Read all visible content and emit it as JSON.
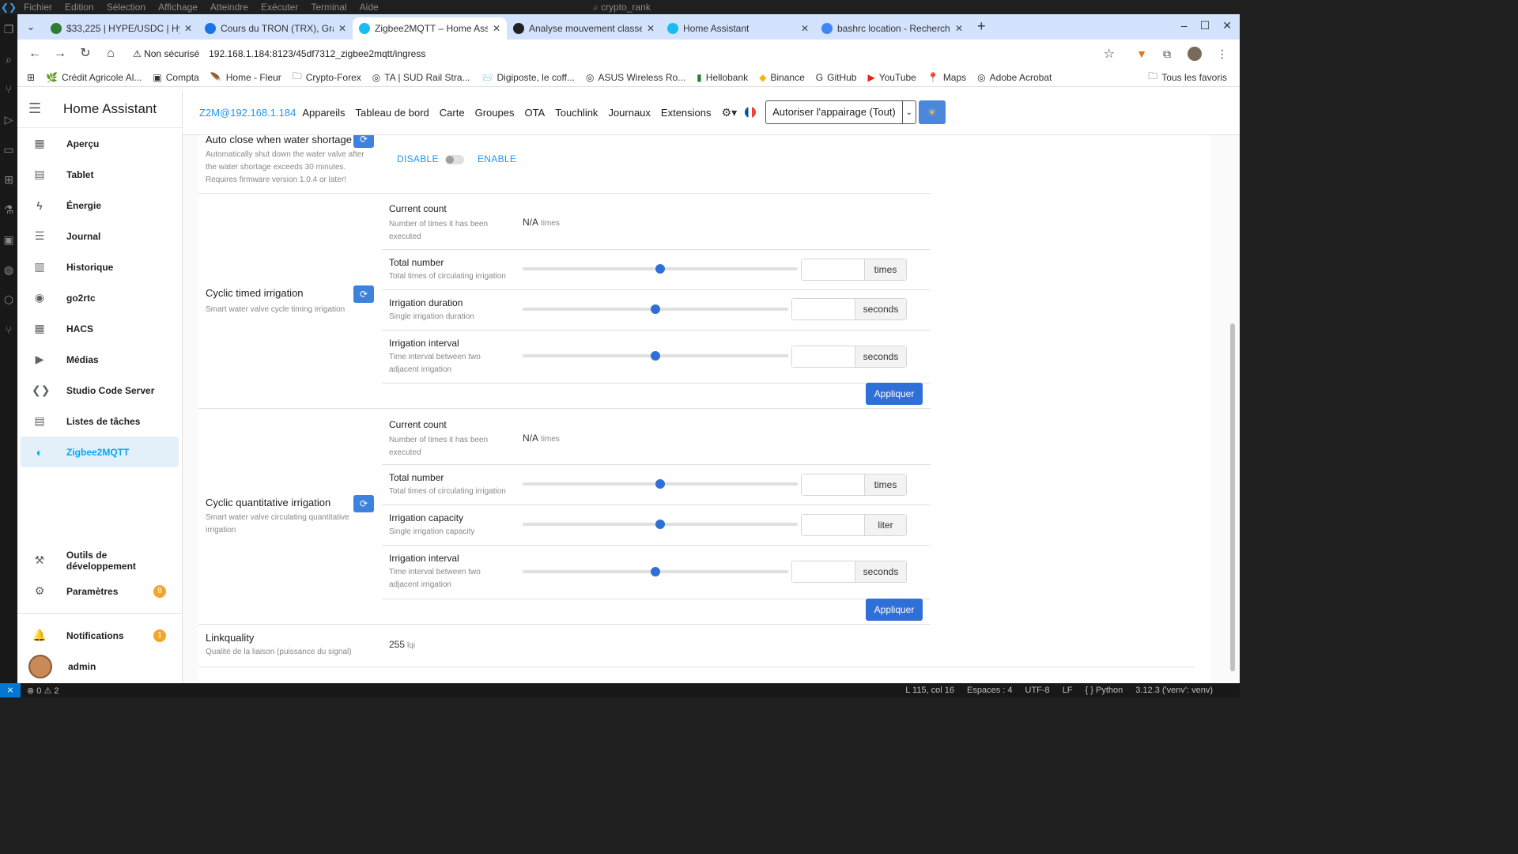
{
  "vscode": {
    "menu": [
      "Fichier",
      "Edition",
      "Sélection",
      "Affichage",
      "Atteindre",
      "Exécuter",
      "Terminal",
      "Aide"
    ],
    "command_center": "crypto_rank",
    "status": {
      "problems": "⊗ 0 ⚠ 2",
      "position": "L 115, col 16",
      "spaces": "Espaces : 4",
      "encoding": "UTF-8",
      "eol": "LF",
      "language": "{ } Python",
      "interpreter": "3.12.3 ('venv': venv)"
    }
  },
  "browser": {
    "tabs": [
      {
        "title": "$33,225 | HYPE/USDC | Hype",
        "color": "#2e7d32"
      },
      {
        "title": "Cours du TRON (TRX), Graph",
        "color": "#1a73e8"
      },
      {
        "title": "Zigbee2MQTT – Home Assist",
        "color": "#18bcf2"
      },
      {
        "title": "Analyse mouvement classem",
        "color": "#222222"
      },
      {
        "title": "Home Assistant",
        "color": "#18bcf2"
      },
      {
        "title": "bashrc location - Recherche",
        "color": "#4285f4"
      }
    ],
    "security_label": "Non sécurisé",
    "url": "192.168.1.184:8123/45df7312_zigbee2mqtt/ingress",
    "bookmarks": [
      {
        "label": "Crédit Agricole Al...",
        "icon": "🌿"
      },
      {
        "label": "Compta",
        "icon": "▣"
      },
      {
        "label": "Home - Fleur",
        "icon": "🪶"
      },
      {
        "label": "Crypto-Forex",
        "icon": "🗀"
      },
      {
        "label": "TA | SUD Rail Stra...",
        "icon": "◎"
      },
      {
        "label": "Digiposte, le coff...",
        "icon": "📨"
      },
      {
        "label": "ASUS Wireless Ro...",
        "icon": "◎"
      },
      {
        "label": "Hellobank",
        "icon": "▮"
      },
      {
        "label": "Binance",
        "icon": "◆"
      },
      {
        "label": "GitHub",
        "icon": "G"
      },
      {
        "label": "YouTube",
        "icon": "▶"
      },
      {
        "label": "Maps",
        "icon": "📍"
      },
      {
        "label": "Adobe Acrobat",
        "icon": "◎"
      }
    ],
    "all_bookmarks": "Tous les favoris"
  },
  "ha": {
    "title": "Home Assistant",
    "nav": [
      {
        "label": "Aperçu",
        "icon": "▦"
      },
      {
        "label": "Tablet",
        "icon": "▤"
      },
      {
        "label": "Énergie",
        "icon": "ϟ"
      },
      {
        "label": "Journal",
        "icon": "☰"
      },
      {
        "label": "Historique",
        "icon": "▥"
      },
      {
        "label": "go2rtc",
        "icon": "◉"
      },
      {
        "label": "HACS",
        "icon": "▦"
      },
      {
        "label": "Médias",
        "icon": "▶"
      },
      {
        "label": "Studio Code Server",
        "icon": "❮❯"
      },
      {
        "label": "Listes de tâches",
        "icon": "▤"
      },
      {
        "label": "Zigbee2MQTT",
        "icon": "◐"
      }
    ],
    "dev_tools": "Outils de développement",
    "settings": "Paramètres",
    "settings_badge": "9",
    "notifications": "Notifications",
    "notifications_badge": "1",
    "user": "admin"
  },
  "z2m": {
    "brand": "Z2M@192.168.1.184",
    "nav": [
      "Appareils",
      "Tableau de bord",
      "Carte",
      "Groupes",
      "OTA",
      "Touchlink",
      "Journaux",
      "Extensions"
    ],
    "permit_join": "Autoriser l'appairage (Tout)",
    "auto_close": {
      "title": "Auto close when water shortage",
      "desc": [
        "Automatically shut down the water valve after",
        "the water shortage exceeds 30 minutes.",
        "Requires firmware version 1.0.4 or later!"
      ],
      "disable": "DISABLE",
      "enable": "ENABLE"
    },
    "cyclic_timed": {
      "title": "Cyclic timed irrigation",
      "desc": "Smart water valve cycle timing irrigation",
      "current_count": {
        "title": "Current count",
        "desc": [
          "Number of times it has been",
          "executed"
        ],
        "value": "N/A",
        "unit": "times"
      },
      "total_number": {
        "title": "Total number",
        "desc": "Total times of circulating irrigation",
        "unit": "times",
        "level": 0.5
      },
      "duration": {
        "title": "Irrigation duration",
        "desc": "Single irrigation duration",
        "unit": "seconds",
        "level": 0.5
      },
      "interval": {
        "title": "Irrigation interval",
        "desc": [
          "Time interval between two",
          "adjacent irrigation"
        ],
        "unit": "seconds",
        "level": 0.5
      },
      "apply": "Appliquer"
    },
    "cyclic_quant": {
      "title": "Cyclic quantitative irrigation",
      "desc": [
        "Smart water valve circulating quantitative",
        "irrigation"
      ],
      "current_count": {
        "title": "Current count",
        "desc": [
          "Number of times it has been",
          "executed"
        ],
        "value": "N/A",
        "unit": "times"
      },
      "total_number": {
        "title": "Total number",
        "desc": "Total times of circulating irrigation",
        "unit": "times",
        "level": 0.5
      },
      "capacity": {
        "title": "Irrigation capacity",
        "desc": "Single irrigation capacity",
        "unit": "liter",
        "level": 0.5
      },
      "interval": {
        "title": "Irrigation interval",
        "desc": [
          "Time interval between two",
          "adjacent irrigation"
        ],
        "unit": "seconds",
        "level": 0.5
      },
      "apply": "Appliquer"
    },
    "linkquality": {
      "title": "Linkquality",
      "desc": "Qualité de la liaison (puissance du signal)",
      "value": "255",
      "unit": "lqi"
    }
  }
}
